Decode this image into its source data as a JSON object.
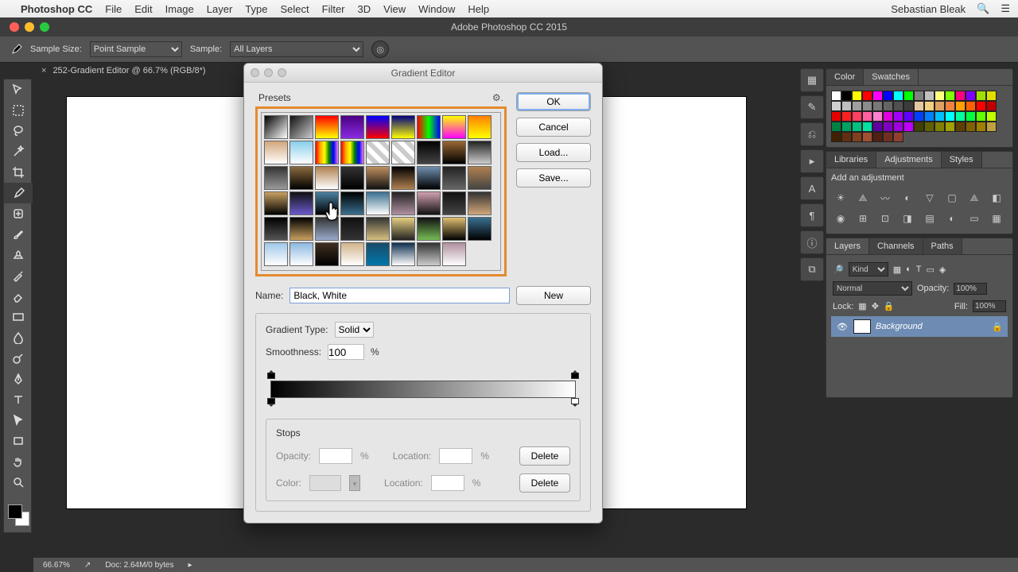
{
  "menubar": {
    "apple": "",
    "app": "Photoshop CC",
    "items": [
      "File",
      "Edit",
      "Image",
      "Layer",
      "Type",
      "Select",
      "Filter",
      "3D",
      "View",
      "Window",
      "Help"
    ],
    "user": "Sebastian Bleak"
  },
  "window": {
    "title": "Adobe Photoshop CC 2015"
  },
  "options_bar": {
    "sample_size_label": "Sample Size:",
    "sample_size_value": "Point Sample",
    "sample_label": "Sample:",
    "sample_value": "All Layers"
  },
  "doc_tab": {
    "label": "252-Gradient Editor @ 66.7% (RGB/8*)",
    "close": "×"
  },
  "status": {
    "zoom": "66.67%",
    "doc": "Doc: 2.64M/0 bytes"
  },
  "panels": {
    "color_tab": "Color",
    "swatches_tab": "Swatches",
    "libraries_tab": "Libraries",
    "adjustments_tab": "Adjustments",
    "styles_tab": "Styles",
    "adjustments_add": "Add an adjustment",
    "layers_tab": "Layers",
    "channels_tab": "Channels",
    "paths_tab": "Paths",
    "layers": {
      "kind_placeholder": "Kind",
      "blend": "Normal",
      "opacity_label": "Opacity:",
      "opacity_value": "100%",
      "lock_label": "Lock:",
      "fill_label": "Fill:",
      "fill_value": "100%",
      "layer_name": "Background"
    }
  },
  "dialog": {
    "title": "Gradient Editor",
    "presets_label": "Presets",
    "ok": "OK",
    "cancel": "Cancel",
    "load": "Load...",
    "save": "Save...",
    "name_label": "Name:",
    "name_value": "Black, White",
    "new_btn": "New",
    "gtype_label": "Gradient Type:",
    "gtype_value": "Solid",
    "smooth_label": "Smoothness:",
    "smooth_value": "100",
    "pct": "%",
    "stops_label": "Stops",
    "opacity_label": "Opacity:",
    "location_label": "Location:",
    "color_label": "Color:",
    "delete_label": "Delete"
  },
  "swatch_colors": [
    "#ffffff",
    "#000000",
    "#ffff00",
    "#ff0000",
    "#ff00ff",
    "#0000ff",
    "#00ffff",
    "#00ff00",
    "#808080",
    "#c0c0c0",
    "#ffff80",
    "#80ff00",
    "#ff0080",
    "#8000ff",
    "#a0e000",
    "#e0e000",
    "#d0d0d0",
    "#bfbfbf",
    "#a0a0a0",
    "#8c8c8c",
    "#787878",
    "#646464",
    "#505050",
    "#3c3c3c",
    "#e6c8a0",
    "#f0d080",
    "#e0a060",
    "#f08040",
    "#ffa000",
    "#ff6000",
    "#ff0000",
    "#c00000",
    "#e60000",
    "#ff2020",
    "#ff4060",
    "#ff60a0",
    "#ff80d0",
    "#e000e0",
    "#a000ff",
    "#6000ff",
    "#0040ff",
    "#0080ff",
    "#00c0ff",
    "#00ffff",
    "#00ffa0",
    "#00ff40",
    "#60ff00",
    "#c0ff00",
    "#008040",
    "#00a060",
    "#00c080",
    "#00e0a0",
    "#6000a0",
    "#8000c0",
    "#a000e0",
    "#c000ff",
    "#404000",
    "#606000",
    "#808000",
    "#a0a000",
    "#604000",
    "#806000",
    "#a08000",
    "#c0a040",
    "#402000",
    "#603010",
    "#804020",
    "#a05030",
    "#502010",
    "#703020",
    "#904030"
  ],
  "preset_gradients": [
    "linear-gradient(135deg,#000,#fff)",
    "linear-gradient(135deg,#111,#ccc)",
    "linear-gradient(#ff0000,#ffff00)",
    "linear-gradient(#4b0082,#8a2be2)",
    "linear-gradient(#0000ff,#ff0000)",
    "linear-gradient(#000080,#ffff00)",
    "linear-gradient(90deg,#ff0000,#00ff00,#0000ff)",
    "linear-gradient(#ffff00,#ff00ff)",
    "linear-gradient(#ff8000,#ffff00)",
    "linear-gradient(#d2a679,#fff)",
    "linear-gradient(#87ceeb,#fff)",
    "linear-gradient(90deg,red,orange,yellow,green,blue,violet)",
    "linear-gradient(90deg,red,orange,yellow,green,blue,violet)",
    "repeating-linear-gradient(45deg,#fff 0 6px,#ccc 6px 12px)",
    "repeating-linear-gradient(45deg,#fff 0 6px,#ccc 6px 12px)",
    "linear-gradient(#000,#444)",
    "linear-gradient(#996633,#000)",
    "linear-gradient(#222,#ccc)",
    "linear-gradient(#333,#999)",
    "linear-gradient(#8b6b3e,#000)",
    "linear-gradient(#b08050,#fff)",
    "linear-gradient(#333,#000)",
    "linear-gradient(#c09060,#111)",
    "linear-gradient(#000,#b08050)",
    "linear-gradient(#7090b0,#000)",
    "linear-gradient(#222,#666)",
    "linear-gradient(#b08050,#444)",
    "linear-gradient(#c9a060,#000)",
    "linear-gradient(#111,#6a5acd)",
    "linear-gradient(#4a80a0,#000)",
    "linear-gradient(#000,#3a6f8f)",
    "linear-gradient(#3a6f8f,#fff)",
    "linear-gradient(#222,#b090a0)",
    "linear-gradient(#d0a0b0,#111)",
    "linear-gradient(#111,#444)",
    "linear-gradient(#333,#d2a679)",
    "linear-gradient(#000,#555)",
    "linear-gradient(#000,#c9a060)",
    "linear-gradient(#333,#9ac)",
    "linear-gradient(#111,#333)",
    "linear-gradient(#333,#d6c080)",
    "linear-gradient(#e6d080,#222)",
    "linear-gradient(#111,#7b5)",
    "linear-gradient(#e0c070,#000)",
    "linear-gradient(#3a6f8f,#000)",
    "linear-gradient(#a0c8e8,#fff)",
    "linear-gradient(#8cb8e0,#fff)",
    "linear-gradient(#403020,#000)",
    "linear-gradient(#d2b48c,#fff)",
    "linear-gradient(#1b4b6b,#07a)",
    "linear-gradient(#103050,#fff)",
    "linear-gradient(#333,#ccc)",
    "linear-gradient(#b090a0,#fff)"
  ]
}
